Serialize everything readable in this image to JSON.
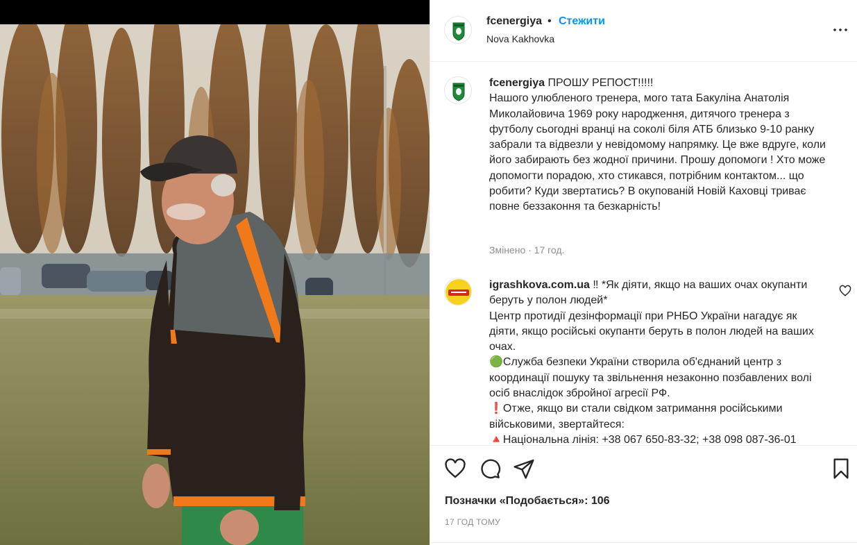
{
  "post": {
    "username": "fcenergiya",
    "follow_label": "Стежити",
    "separator": "•",
    "location": "Nova Kakhovka"
  },
  "caption": {
    "username": "fcenergiya",
    "text": "ПРОШУ РЕПОСТ!!!!!\nНашого улюбленого тренера, мого тата Бакуліна Анатолія Миколайовича 1969 року народження, дитячого тренера з футболу сьогодні вранці на соколі біля АТБ близько 9-10 ранку забрали та відвезли у невідомому напрямку. Це вже вдруге, коли його забирають без жодної причини. Прошу допомоги ! Хто може допомогти порадою, хто стикався, потрібним контактом... що робити? Куди звертатись? В окупованій Новій Каховці триває повне беззаконня та безкарність!",
    "meta": "Змінено · 17 год."
  },
  "reply": {
    "username": "igrashkova.com.ua",
    "text1": " ‼ *Як діяти, якщо на ваших очах окупанти беруть у полон людей*\nЦентр протидії дезінформації при РНБО України нагадує як діяти, якщо російські окупанти беруть в полон людей на ваших очах.\n",
    "bullet1_icon": "🟢",
    "text2": "Служба безпеки України створила об'єднаний центр з координації пошуку та звільнення незаконно позбавлених волі осіб внаслідок збройної агресії РФ.\n",
    "bullet2_icon": "❗",
    "text3": "Отже, якщо ви стали свідком затримання російськими військовими, звертайтеся:\n",
    "bullet3_icon": "🔺",
    "text4": "Національна лінія: +38 067 650-83-32; +38 098 087-36-01"
  },
  "footer": {
    "likes": "Позначки «Подобається»: 106",
    "time": "17 ГОД ТОМУ"
  },
  "icons": {
    "like": "heart-icon",
    "comment": "comment-icon",
    "share": "paper-plane-icon",
    "save": "bookmark-icon",
    "more": "more-icon",
    "reply_like": "heart-icon"
  },
  "colors": {
    "link": "#0095f6",
    "secondary": "#8e8e8e",
    "text": "#262626"
  }
}
